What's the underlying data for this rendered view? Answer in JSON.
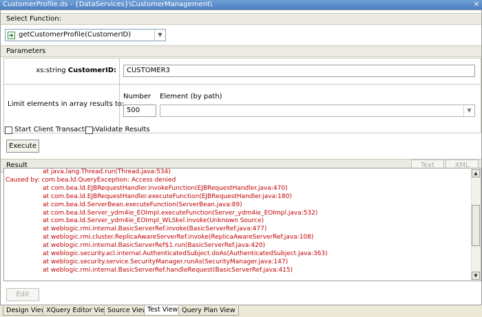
{
  "window": {
    "title": "CustomerProfile.ds - {DataServices}\\CustomerManagement\\",
    "close_glyph": "×"
  },
  "select_function": {
    "header": "Select Function:",
    "selected": "getCustomerProfile(CustomerID)"
  },
  "parameters": {
    "header": "Parameters",
    "param_type": "xs:string",
    "param_name": "CustomerID:",
    "param_value": "CUSTOMER3",
    "limit_label": "Limit elements in array results to:",
    "number_label": "Number",
    "element_label": "Element (by path)",
    "number_value": "500"
  },
  "options": {
    "start_transaction": "Start Client Transaction",
    "validate_results": "Validate Results"
  },
  "execute_label": "Execute",
  "result": {
    "header": "Result",
    "text_button": "Text",
    "xml_button": "XML",
    "lines": [
      "at java.lang.Thread.run(Thread.java:534)",
      "Caused by: com.bea.ld.QueryException: Access denied",
      "at com.bea.ld.EJBRequestHandler.invokeFunction(EJBRequestHandler.java:470)",
      "at com.bea.ld.EJBRequestHandler.executeFunction(EJBRequestHandler.java:180)",
      "at com.bea.ld.ServerBean.executeFunction(ServerBean.java:89)",
      "at com.bea.ld.Server_ydm4ie_EOImpl.executeFunction(Server_ydm4ie_EOImpl.java:532)",
      "at com.bea.ld.Server_ydm4ie_EOImpl_WLSkel.invoke(Unknown Source)",
      "at weblogic.rmi.internal.BasicServerRef.invoke(BasicServerRef.java:477)",
      "at weblogic.rmi.cluster.ReplicaAwareServerRef.invoke(ReplicaAwareServerRef.java:108)",
      "at weblogic.rmi.internal.BasicServerRef$1.run(BasicServerRef.java:420)",
      "at weblogic.security.acl.internal.AuthenticatedSubject.doAs(AuthenticatedSubject.java:363)",
      "at weblogic.security.service.SecurityManager.runAs(SecurityManager.java:147)",
      "at weblogic.rmi.internal.BasicServerRef.handleRequest(BasicServerRef.java:415)"
    ]
  },
  "edit_label": "Edit",
  "tabs": [
    {
      "label": "Design View"
    },
    {
      "label": "XQuery Editor View"
    },
    {
      "label": "Source View"
    },
    {
      "label": "Test View"
    },
    {
      "label": "Query Plan View"
    }
  ],
  "colors": {
    "error_text": "#c00000",
    "title_bar": "#4b7fc2"
  }
}
